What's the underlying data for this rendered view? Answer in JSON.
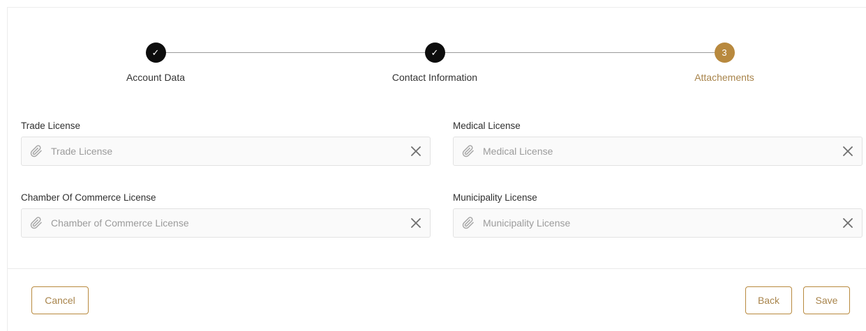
{
  "stepper": {
    "steps": [
      {
        "label": "Account Data",
        "state": "completed",
        "marker": "✓"
      },
      {
        "label": "Contact Information",
        "state": "completed",
        "marker": "✓"
      },
      {
        "label": "Attachements",
        "state": "active",
        "marker": "3"
      }
    ]
  },
  "form": {
    "trade_license": {
      "label": "Trade License",
      "placeholder": "Trade License"
    },
    "medical_license": {
      "label": "Medical License",
      "placeholder": "Medical License"
    },
    "chamber_license": {
      "label": "Chamber Of Commerce License",
      "placeholder": "Chamber of Commerce License"
    },
    "municipality_license": {
      "label": "Municipality License",
      "placeholder": "Municipality License"
    }
  },
  "icons": {
    "attach": "paperclip-icon",
    "clear": "close-icon"
  },
  "footer": {
    "cancel_label": "Cancel",
    "back_label": "Back",
    "save_label": "Save"
  },
  "colors": {
    "accent": "#b8893e",
    "completed": "#0d0d0d",
    "accent_text": "#a8844b"
  }
}
